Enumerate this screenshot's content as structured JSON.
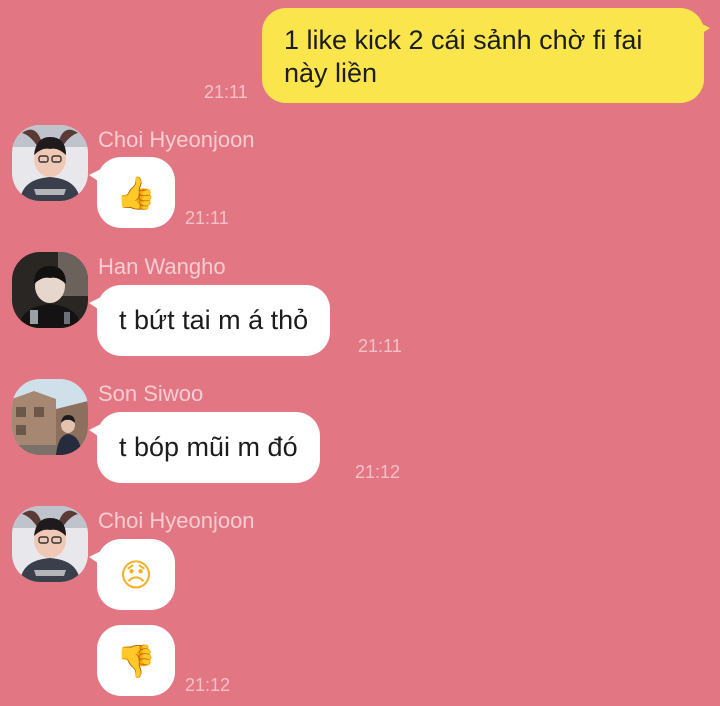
{
  "outgoing": {
    "text": "1 like kick 2 cái sảnh chờ fi fai này liền",
    "time": "21:11"
  },
  "messages": [
    {
      "sender": "Choi Hyeonjoon",
      "avatar": "avatar-photo",
      "content": "👍",
      "content_type": "emoji",
      "emoji_name": "thumbs-up-icon",
      "time": "21:11"
    },
    {
      "sender": "Han Wangho",
      "avatar": "avatar-photo",
      "content": "t bứt tai m á thỏ",
      "content_type": "text",
      "time": "21:11"
    },
    {
      "sender": "Son Siwoo",
      "avatar": "avatar-photo",
      "content": "t bóp mũi m đó",
      "content_type": "text",
      "time": "21:12"
    },
    {
      "sender": "Choi Hyeonjoon",
      "avatar": "avatar-photo",
      "content": "😞",
      "content_type": "emoji",
      "emoji_name": "disappointed-face-icon",
      "time": ""
    },
    {
      "sender": "",
      "avatar": "",
      "content": "👎",
      "content_type": "emoji",
      "emoji_name": "thumbs-down-icon",
      "time": "21:12"
    }
  ],
  "colors": {
    "background": "#E37683",
    "outgoing_bubble": "#FAE64C",
    "incoming_bubble": "#FFFFFF",
    "timestamp": "#F3C2C8",
    "sender_name": "#F5CDD2"
  }
}
